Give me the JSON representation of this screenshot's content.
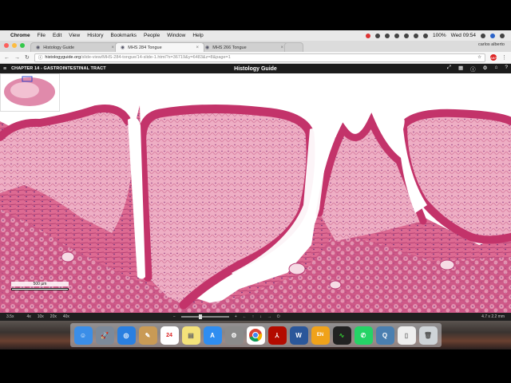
{
  "menubar": {
    "app": "Chrome",
    "items": [
      "File",
      "Edit",
      "View",
      "History",
      "Bookmarks",
      "People",
      "Window",
      "Help"
    ],
    "battery": "100%",
    "clock": "Wed 09:54"
  },
  "browser": {
    "tabs": [
      {
        "label": "Histology Guide",
        "active": false
      },
      {
        "label": "MHS 284 Tongue",
        "active": true
      },
      {
        "label": "MHS 266 Tongue",
        "active": false
      }
    ],
    "user": "carlos alberto",
    "url_host": "histologyguide.org",
    "url_path": "/slide-view/MHS-284-tongue/14-slide-1.html?x=36719&y=6483&z=8&page=1"
  },
  "viewer": {
    "chapter": "CHAPTER 14 - GASTROINTESTINAL TRACT",
    "title": "Histology Guide",
    "scale_label": "500 µm"
  },
  "status": {
    "zoom": "3.5x",
    "zoom_presets": [
      "4x",
      "10x",
      "20x",
      "40x"
    ],
    "dimensions": "4.7 x 2.2 mm"
  },
  "colors": {
    "tissue_pink": "#e47a9e",
    "tissue_light": "#f1b9cc",
    "epithelium": "#c3336a",
    "muscle": "#d25b86"
  },
  "dock": [
    "finder-icon",
    "launchpad-icon",
    "safari-icon",
    "notes-icon",
    "calendar-icon",
    "stickies-icon",
    "appstore-icon",
    "settings-icon",
    "chrome-icon",
    "acrobat-icon",
    "word-icon",
    "dictionary-icon",
    "activity-icon",
    "whatsapp-icon",
    "quicktime-icon",
    "document-icon",
    "trash-icon"
  ],
  "calendar_day": "24",
  "dict_label": "EN"
}
